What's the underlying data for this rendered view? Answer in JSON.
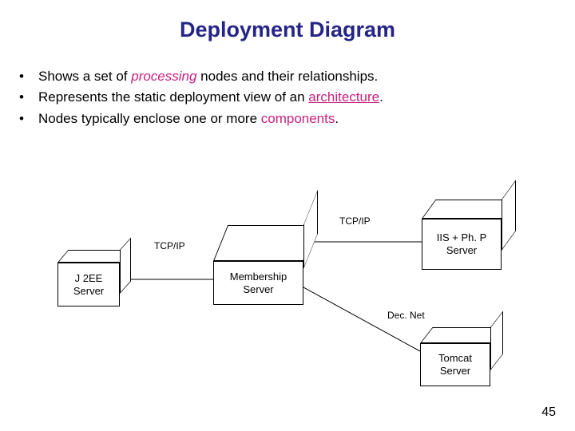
{
  "title": "Deployment Diagram",
  "bullets": [
    {
      "pre": "Shows a set of ",
      "em": "processing",
      "em_style": "italic",
      "post": " nodes and their relationships."
    },
    {
      "pre": "Represents the static deployment view of an ",
      "em": "architecture",
      "em_style": "underline",
      "post": "."
    },
    {
      "pre": "Nodes typically enclose one or more ",
      "em": "components",
      "em_style": "plain",
      "post": "."
    }
  ],
  "nodes": {
    "j2ee": {
      "label": "J 2EE\nServer"
    },
    "membership": {
      "label": "Membership\nServer"
    },
    "iis": {
      "label": "IIS + Ph. P\nServer"
    },
    "tomcat": {
      "label": "Tomcat\nServer"
    }
  },
  "edges": {
    "e1": {
      "label": "TCP/IP"
    },
    "e2": {
      "label": "TCP/IP"
    },
    "e3": {
      "label": "Dec. Net"
    }
  },
  "page_number": "45"
}
